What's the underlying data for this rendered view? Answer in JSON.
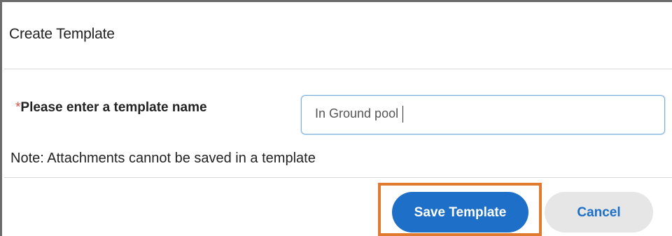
{
  "dialog": {
    "title": "Create Template",
    "field": {
      "required_marker": "*",
      "label": "Please enter a template name",
      "value": "In Ground pool"
    },
    "note": "Note: Attachments cannot be saved in a template",
    "buttons": {
      "save_label": "Save Template",
      "cancel_label": "Cancel"
    }
  },
  "colors": {
    "primary": "#1d6fc8",
    "required": "#d9534f",
    "highlight": "#e07a2f",
    "cancel_bg": "#e6e6e6"
  }
}
